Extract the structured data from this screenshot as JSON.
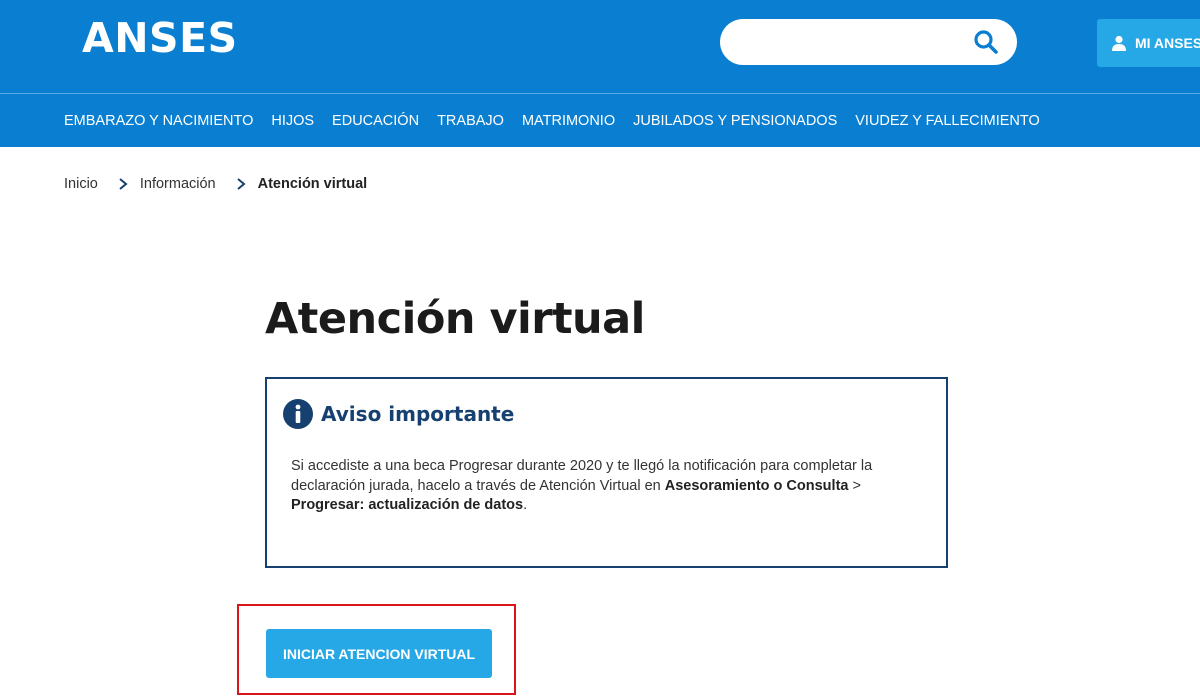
{
  "colors": {
    "brand": "#0a7fd1",
    "button_accent": "#27a8e6",
    "notice_border": "#16406f",
    "highlight": "#d9151b"
  },
  "header": {
    "logo": "ANSES",
    "search": {
      "value": "",
      "placeholder": "",
      "icon": "search-icon"
    },
    "account_button": {
      "label": "MI ANSES",
      "icon": "user-icon"
    }
  },
  "nav": {
    "items": [
      "EMBARAZO Y NACIMIENTO",
      "HIJOS",
      "EDUCACIÓN",
      "TRABAJO",
      "MATRIMONIO",
      "JUBILADOS Y PENSIONADOS",
      "VIUDEZ Y FALLECIMIENTO"
    ]
  },
  "breadcrumb": {
    "items": [
      "Inicio",
      "Información",
      "Atención virtual"
    ],
    "separator_icon": "chevron-right-icon"
  },
  "main": {
    "title": "Atención virtual",
    "notice": {
      "icon": "info-icon",
      "title": "Aviso importante",
      "text_part1": "Si accediste a una beca Progresar durante 2020 y te llegó la notificación para completar la declaración jurada, hacelo a través de Atención Virtual en ",
      "bold1": "Asesoramiento o Consulta",
      "text_part2": " > ",
      "bold2": "Progresar: actualización de datos",
      "text_part3": "."
    },
    "start_button": {
      "label": "INICIAR ATENCION VIRTUAL"
    }
  }
}
